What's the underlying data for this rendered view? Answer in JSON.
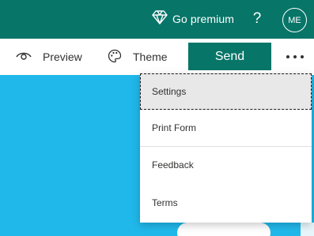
{
  "topbar": {
    "premium_label": "Go premium",
    "premium_icon": "diamond-icon",
    "help_label": "?",
    "avatar_initials": "ME",
    "background": "#077568"
  },
  "commandbar": {
    "preview_label": "Preview",
    "preview_icon": "eye-icon",
    "theme_label": "Theme",
    "theme_icon": "palette-icon",
    "send_label": "Send",
    "more_icon": "more-horizontal-icon"
  },
  "menu": {
    "items": [
      {
        "label": "Settings",
        "state": "focused"
      },
      {
        "label": "Print Form"
      },
      {
        "label": "Feedback"
      },
      {
        "label": "Terms"
      }
    ]
  },
  "colors": {
    "accent": "#077568",
    "canvas_background": "#20b8ea",
    "menu_hover": "#e8e8e8"
  }
}
